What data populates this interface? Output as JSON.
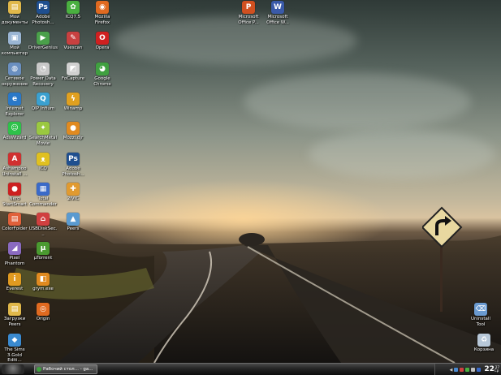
{
  "desktop": {
    "icons": [
      {
        "label": "Мои\nдокументы",
        "icon": "folder-icon",
        "color": "#e0b84a",
        "glyph": "▤"
      },
      {
        "label": "Мой\nкомпьютер",
        "icon": "computer-icon",
        "color": "#9bb6d4",
        "glyph": "▣"
      },
      {
        "label": "Сетевое\nокружение",
        "icon": "network-icon",
        "color": "#6a8fc0",
        "glyph": "◍"
      },
      {
        "label": "Internet\nExplorer",
        "icon": "ie-icon",
        "color": "#2a78c8",
        "glyph": "e"
      },
      {
        "label": "AdsWizard",
        "icon": "adswizard-icon",
        "color": "#2ec24a",
        "glyph": "☺"
      },
      {
        "label": "Ashampoo\nUninstall ...",
        "icon": "ashampoo-icon",
        "color": "#d03030",
        "glyph": "A"
      },
      {
        "label": "Nero\nStartSmart",
        "icon": "nero-icon",
        "color": "#cc2020",
        "glyph": "●"
      },
      {
        "label": "ColorFolder",
        "icon": "colorfolder-icon",
        "color": "#e0603a",
        "glyph": "▤"
      },
      {
        "label": "Pixel Phantom",
        "icon": "pixelphantom-icon",
        "color": "#8a6ac0",
        "glyph": "◢"
      },
      {
        "label": "Everest",
        "icon": "everest-icon",
        "color": "#e09a20",
        "glyph": "i"
      },
      {
        "label": "Загрузки\nPeers",
        "icon": "downloads-folder-icon",
        "color": "#e0b84a",
        "glyph": "▤"
      },
      {
        "label": "The Sims\n3.Gold Editi...",
        "icon": "sims-icon",
        "color": "#3a8ad0",
        "glyph": "◆"
      },
      {
        "label": "Adobe\nPhotosh...",
        "icon": "photoshop-icon",
        "color": "#1f4f8f",
        "glyph": "Ps"
      },
      {
        "label": "DriverGenius",
        "icon": "drivergenius-icon",
        "color": "#4aa04a",
        "glyph": "▶"
      },
      {
        "label": "Power Data\nRecovery",
        "icon": "powerdata-icon",
        "color": "#c8c8c8",
        "glyph": "◔"
      },
      {
        "label": "QIP Infium",
        "icon": "qip-icon",
        "color": "#3aa0d0",
        "glyph": "Q"
      },
      {
        "label": "SearchMetal\nMovie",
        "icon": "searchmetal-icon",
        "color": "#9ac840",
        "glyph": "✦"
      },
      {
        "label": "ICQ",
        "icon": "batman-icon",
        "color": "#e0c020",
        "glyph": "ᴥ"
      },
      {
        "label": "Total\nCommander",
        "icon": "totalcommander-icon",
        "color": "#3a6ac8",
        "glyph": "▦"
      },
      {
        "label": "USBDiskSec...",
        "icon": "usbdisksecurity-icon",
        "color": "#d04040",
        "glyph": "⌂"
      },
      {
        "label": "µTorrent",
        "icon": "utorrent-icon",
        "color": "#4a9a30",
        "glyph": "µ"
      },
      {
        "label": "grym.exe",
        "icon": "grym-icon",
        "color": "#e08a20",
        "glyph": "◧"
      },
      {
        "label": "Origin",
        "icon": "origin-icon",
        "color": "#e06a20",
        "glyph": "◎"
      },
      {
        "label": "ICQ7.5",
        "icon": "icq-icon",
        "color": "#4ab040",
        "glyph": "✿"
      },
      {
        "label": "Vuescan",
        "icon": "vuescan-icon",
        "color": "#c84040",
        "glyph": "✎"
      },
      {
        "label": "FoCapture",
        "icon": "focapture-icon",
        "color": "#d0d0d0",
        "glyph": "◩"
      },
      {
        "label": "Winamp",
        "icon": "winamp-icon",
        "color": "#e0a020",
        "glyph": "ϟ"
      },
      {
        "label": "Mozzi.djr",
        "icon": "mozzi-icon",
        "color": "#e08a20",
        "glyph": "●"
      },
      {
        "label": "Adobe\nPhotosh...",
        "icon": "photoshop2-icon",
        "color": "#1f4f8f",
        "glyph": "Ps"
      },
      {
        "label": "2IVIC",
        "icon": "2ivic-icon",
        "color": "#e09a30",
        "glyph": "✚"
      },
      {
        "label": "Peers",
        "icon": "peers-icon",
        "color": "#5a9ad0",
        "glyph": "▲"
      },
      {
        "label": "Mozilla Firefox",
        "icon": "firefox-icon",
        "color": "#e06a20",
        "glyph": "◉"
      },
      {
        "label": "Opera",
        "icon": "opera-icon",
        "color": "#d02020",
        "glyph": "O"
      },
      {
        "label": "Google\nChrome",
        "icon": "chrome-icon",
        "color": "#40a040",
        "glyph": "◕"
      },
      {
        "label": "Microsoft\nOffice P...",
        "icon": "powerpoint-icon",
        "color": "#d05020",
        "glyph": "P"
      },
      {
        "label": "Microsoft\nOffice W...",
        "icon": "word-icon",
        "color": "#3a5aa8",
        "glyph": "W"
      },
      {
        "label": "Uninstall Tool",
        "icon": "uninstalltool-icon",
        "color": "#6a9ad0",
        "glyph": "⌫"
      },
      {
        "label": "Корзина",
        "icon": "recycle-bin-icon",
        "color": "#b8c8d8",
        "glyph": "♻"
      }
    ]
  },
  "taskbar": {
    "task_label": "Рабочий стол... - ga...",
    "clock_hour": "22",
    "clock_min": "27",
    "clock_sub": "Ср"
  }
}
